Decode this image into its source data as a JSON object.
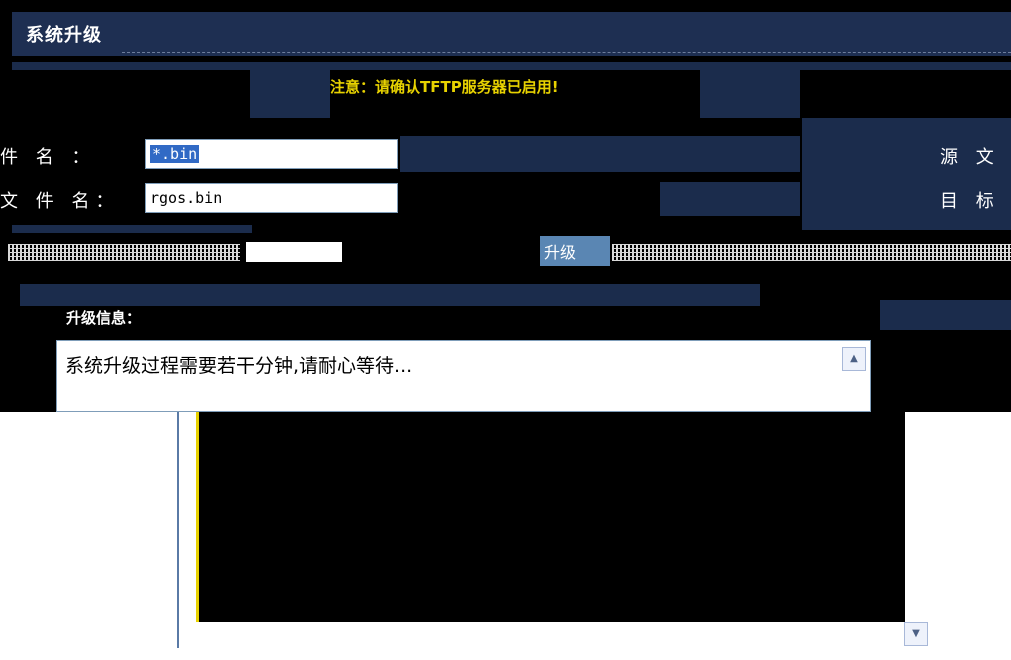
{
  "window": {
    "title": "系统升级"
  },
  "notice": {
    "text": "注意：请确认TFTP服务器已启用!"
  },
  "form": {
    "source_file": {
      "label_left": "件 名 ：",
      "value": "*.bin",
      "label_right": "源 文"
    },
    "target_file": {
      "label_left": "文 件 名：",
      "value": "rgos.bin",
      "label_right": "目 标"
    },
    "upgrade_button_label": "升级"
  },
  "info": {
    "label": "升级信息：",
    "message": "系统升级过程需要若干分钟,请耐心等待..."
  },
  "icons": {
    "scroll_up": "chevron-up-icon",
    "scroll_down": "chevron-down-icon"
  },
  "colors": {
    "title_bar": "#1e2f52",
    "notice_text": "#e8d200",
    "button": "#5a86b3",
    "selection": "#316ac5"
  }
}
